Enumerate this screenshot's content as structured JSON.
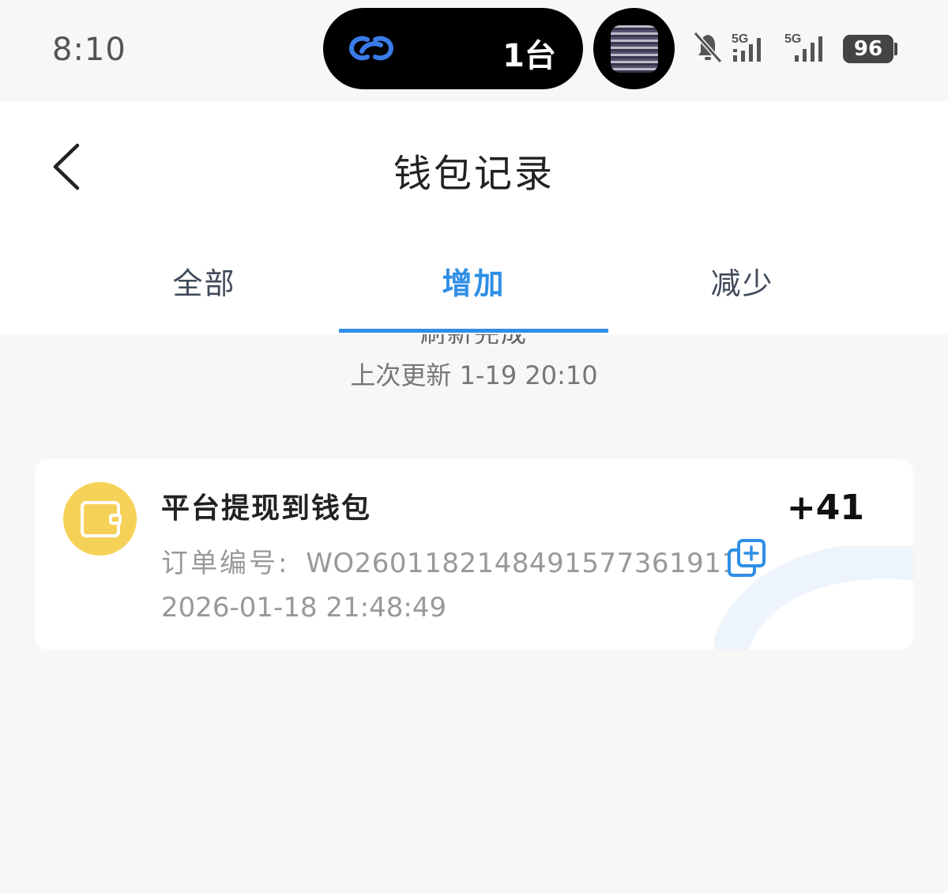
{
  "status_bar": {
    "time": "8:10",
    "island_count": "1台",
    "network_1": "5G",
    "network_2": "5G",
    "battery": "96",
    "icons": [
      "link-icon",
      "avatar-thumbnail",
      "bell-muted-icon",
      "signal-icon",
      "signal-icon"
    ]
  },
  "header": {
    "title": "钱包记录",
    "back_icon": "chevron-left-icon"
  },
  "tabs": [
    {
      "label": "全部",
      "active": false
    },
    {
      "label": "增加",
      "active": true
    },
    {
      "label": "减少",
      "active": false
    }
  ],
  "refresh": {
    "status_text": "刷新完成",
    "last_update": "上次更新 1-19 20:10"
  },
  "records": [
    {
      "icon": "wallet-icon",
      "title": "平台提现到钱包",
      "order_label": "订单编号:",
      "order_number": "WO260118214849157736191​1",
      "date": "2026-01-18 21:48:49",
      "amount": "+41",
      "copy_icon": "copy-icon"
    }
  ],
  "colors": {
    "accent": "#2f8fe6",
    "wallet_icon_bg": "#f5d257",
    "page_bg": "#f7f7f8"
  }
}
